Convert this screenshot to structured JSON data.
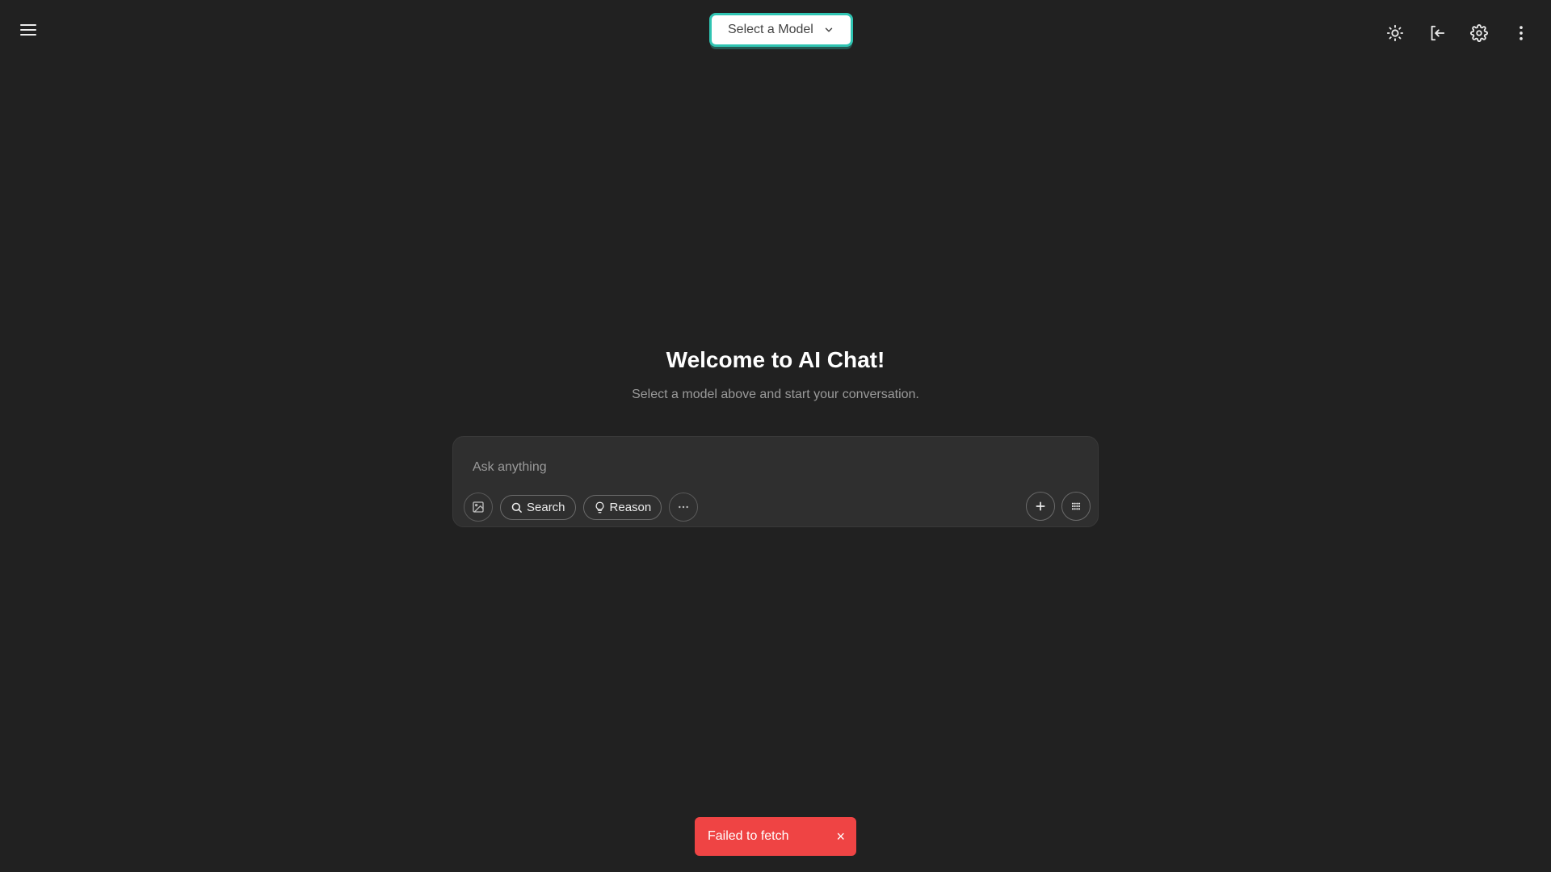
{
  "header": {
    "menu_icon": "hamburger-menu-icon",
    "model_select_label": "Select a Model",
    "icons": [
      "sun-icon",
      "logout-icon",
      "gear-icon",
      "more-vertical-icon"
    ]
  },
  "welcome": {
    "title": "Welcome to AI Chat!",
    "subtitle": "Select a model above and start your conversation."
  },
  "composer": {
    "placeholder": "Ask anything",
    "search_label": "Search",
    "reason_label": "Reason"
  },
  "toast": {
    "message": "Failed to fetch",
    "close": "×"
  },
  "colors": {
    "background": "#212121",
    "accent": "#2fc4b2",
    "error": "#ef4444"
  }
}
